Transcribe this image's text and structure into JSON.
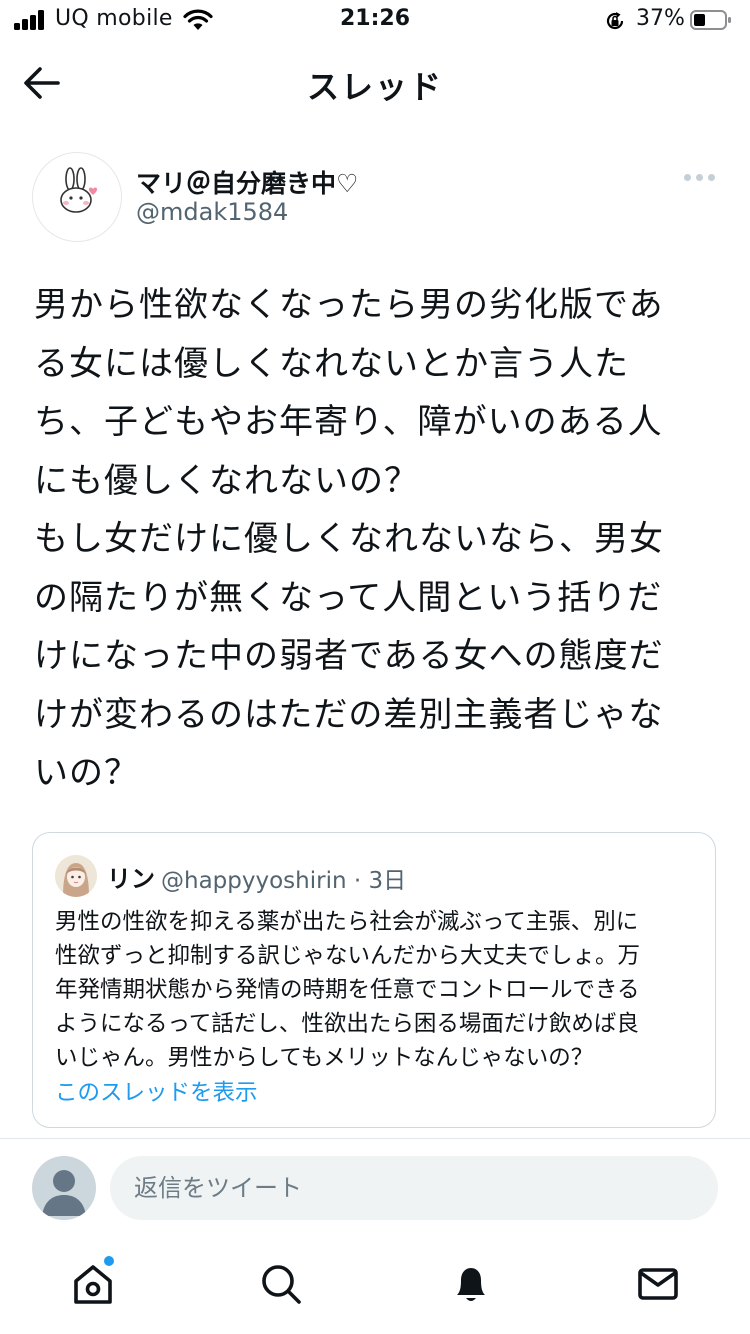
{
  "status_bar": {
    "carrier": "UQ mobile",
    "time": "21:26",
    "battery_percent": "37%"
  },
  "header": {
    "title": "スレッド"
  },
  "tweet": {
    "author_name": "マリ＠自分磨き中♡",
    "author_handle": "@mdak1584",
    "text": "男から性欲なくなったら男の劣化版であ\nる女には優しくなれないとか言う人た\nち、子どもやお年寄り、障がいのある人\nにも優しくなれないの？\nもし女だけに優しくなれないなら、男女\nの隔たりが無くなって人間という括りだ\nけになった中の弱者である女への態度だ\nけが変わるのはただの差別主義者じゃな\nいの？"
  },
  "quote": {
    "author_name": "リン",
    "author_handle": "@happyyoshirin",
    "time": "· 3日",
    "text": "男性の性欲を抑える薬が出たら社会が滅ぶって主張、別に\n性欲ずっと抑制する訳じゃないんだから大丈夫でしょ。万\n年発情期状態から発情の時期を任意でコントロールできる\nようになるって話だし、性欲出たら困る場面だけ飲めば良\nいじゃん。男性からしてもメリットなんじゃないの？",
    "show_thread": "このスレッドを表示"
  },
  "reply": {
    "placeholder": "返信をツイート"
  },
  "tab_bar": {
    "icons": [
      "home-icon",
      "search-icon",
      "notifications-icon",
      "messages-icon"
    ],
    "home_has_badge": true
  },
  "colors": {
    "accent": "#1d9bf0",
    "text": "#0f1419",
    "secondary": "#536471",
    "border": "#cfd9de"
  }
}
